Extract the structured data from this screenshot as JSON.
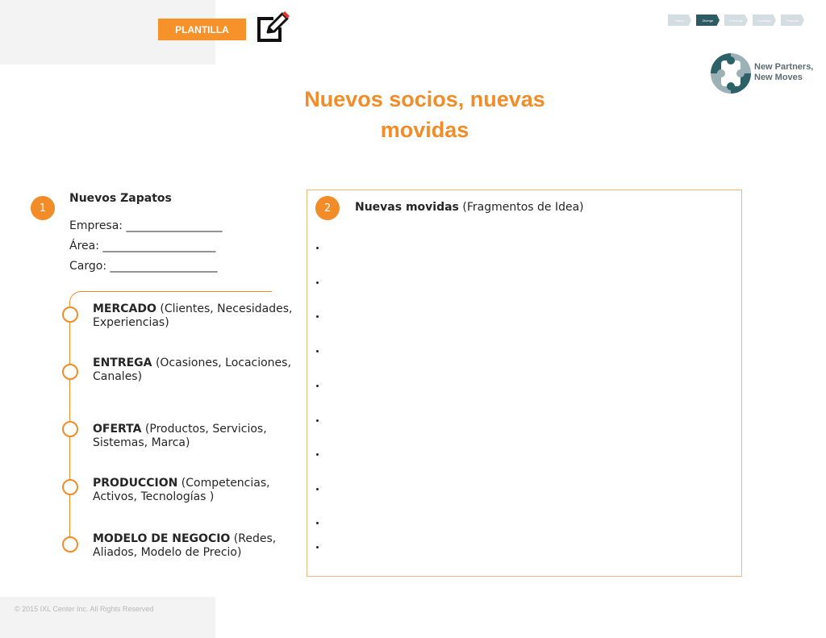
{
  "header": {
    "tag_label": "PLANTILLA"
  },
  "nav": {
    "steps": [
      {
        "label": "Setup",
        "active": false
      },
      {
        "label": "Diverge",
        "active": true
      },
      {
        "label": "Converge",
        "active": false
      },
      {
        "label": "Leverage",
        "active": false
      },
      {
        "label": "Propose",
        "active": false
      }
    ]
  },
  "brand": {
    "line1": "New Partners,",
    "line2": "New Moves"
  },
  "title": {
    "line1": "Nuevos socios, nuevas",
    "line2": "movidas"
  },
  "section1": {
    "number": "1",
    "heading": "Nuevos Zapatos",
    "empresa": "Empresa: _________________",
    "area": "Área: ____________________",
    "cargo": "Cargo: ___________________"
  },
  "steps": [
    {
      "bold": "MERCADO",
      "rest": " (Clientes, Necesidades, Experiencias)"
    },
    {
      "bold": "ENTREGA",
      "rest": " (Ocasiones, Locaciones, Canales)"
    },
    {
      "bold": "OFERTA",
      "rest": " (Productos, Servicios, Sistemas, Marca)"
    },
    {
      "bold": "PRODUCCION",
      "rest": " (Competencias, Activos, Tecnologías )"
    },
    {
      "bold": "MODELO DE NEGOCIO",
      "rest": " (Redes, Aliados, Modelo de Precio)"
    }
  ],
  "section2": {
    "number": "2",
    "heading_bold": "Nuevas movidas",
    "heading_rest": " (Fragmentos de Idea)"
  },
  "colors": {
    "accent": "#f28c28",
    "tag": "#f7922a",
    "brand_dark": "#2d5b63",
    "brand_light": "#8fa6ab"
  },
  "icons": {
    "edit": "edit-icon",
    "logo": "puzzle-logo-icon"
  },
  "footer": {
    "copyright": "© 2015 IXL Center Inc. All Rights Reserved"
  }
}
